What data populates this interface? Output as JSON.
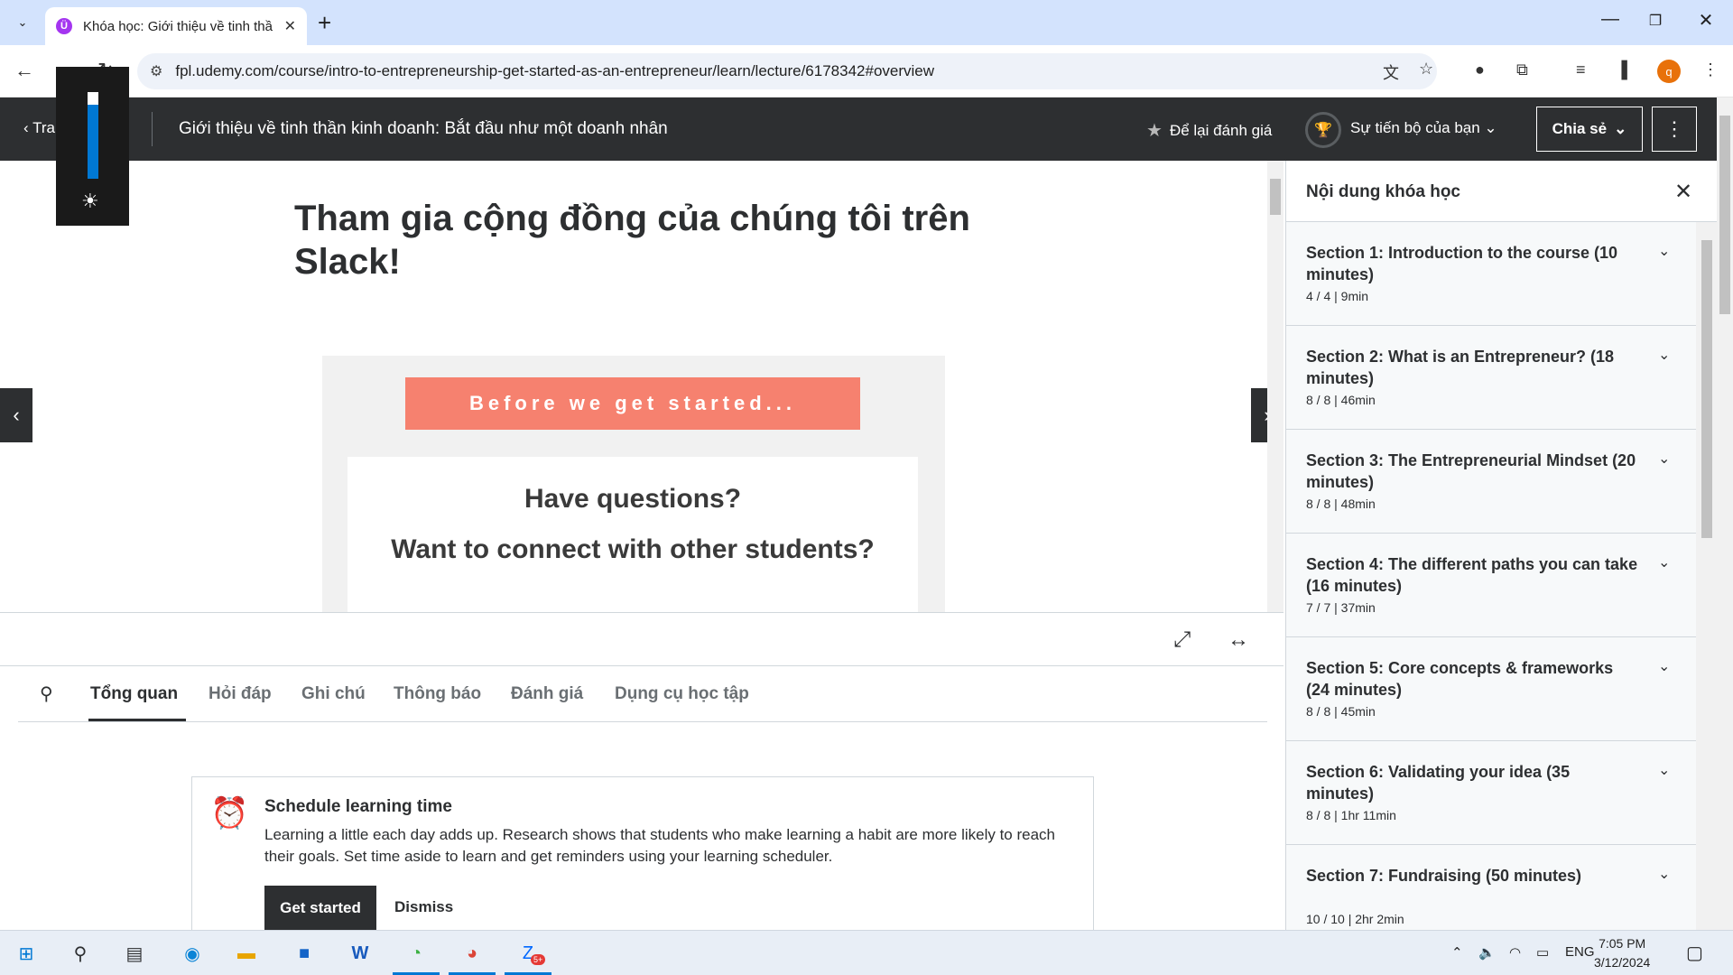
{
  "browser": {
    "tab_title": "Khóa học: Giới thiệu về tinh thầ",
    "favicon_letter": "Ü",
    "url": "fpl.udemy.com/course/intro-to-entrepreneurship-get-started-as-an-entrepreneur/learn/lecture/6178342#overview",
    "profile_initial": "q"
  },
  "header": {
    "back_label": "Trang chủ",
    "course_title": "Giới thiệu về tinh thần kinh doanh: Bắt đầu như một doanh nhân",
    "rating_label": "Để lại đánh giá",
    "progress_label": "Sự tiến bộ của bạn",
    "share_label": "Chia sẻ"
  },
  "brightness": {
    "level": 0.85
  },
  "lecture": {
    "title": "Tham gia cộng đồng của chúng tôi trên Slack!",
    "banner": "Before we get started...",
    "question1": "Have questions?",
    "question2": "Want to connect with other students?"
  },
  "tabs": [
    {
      "label": "Tổng quan",
      "active": true
    },
    {
      "label": "Hỏi đáp",
      "active": false
    },
    {
      "label": "Ghi chú",
      "active": false
    },
    {
      "label": "Thông báo",
      "active": false
    },
    {
      "label": "Đánh giá",
      "active": false
    },
    {
      "label": "Dụng cụ học tập",
      "active": false
    }
  ],
  "schedule": {
    "title": "Schedule learning time",
    "text": "Learning a little each day adds up. Research shows that students who make learning a habit are more likely to reach their goals. Set time aside to learn and get reminders using your learning scheduler.",
    "primary_label": "Get started",
    "dismiss_label": "Dismiss"
  },
  "sidebar": {
    "title": "Nội dung khóa học",
    "sections": [
      {
        "title": "Section 1: Introduction to the course (10 minutes)",
        "meta": "4 / 4 | 9min"
      },
      {
        "title": "Section 2: What is an Entrepreneur? (18 minutes)",
        "meta": "8 / 8 | 46min"
      },
      {
        "title": "Section 3: The Entrepreneurial Mindset (20 minutes)",
        "meta": "8 / 8 | 48min"
      },
      {
        "title": "Section 4: The different paths you can take (16 minutes)",
        "meta": "7 / 7 | 37min"
      },
      {
        "title": "Section 5: Core concepts & frameworks (24 minutes)",
        "meta": "8 / 8 | 45min"
      },
      {
        "title": "Section 6: Validating your idea (35 minutes)",
        "meta": "8 / 8 | 1hr 11min"
      },
      {
        "title": "Section 7: Fundraising (50 minutes)",
        "meta": "10 / 10 | 2hr 2min"
      }
    ]
  },
  "taskbar": {
    "language": "ENG",
    "time": "7:05 PM",
    "date": "3/12/2024",
    "zalo_badge": "5+"
  },
  "colors": {
    "udemy_dark": "#2d2f31",
    "banner": "#f6816f",
    "accent": "#a435f0"
  }
}
